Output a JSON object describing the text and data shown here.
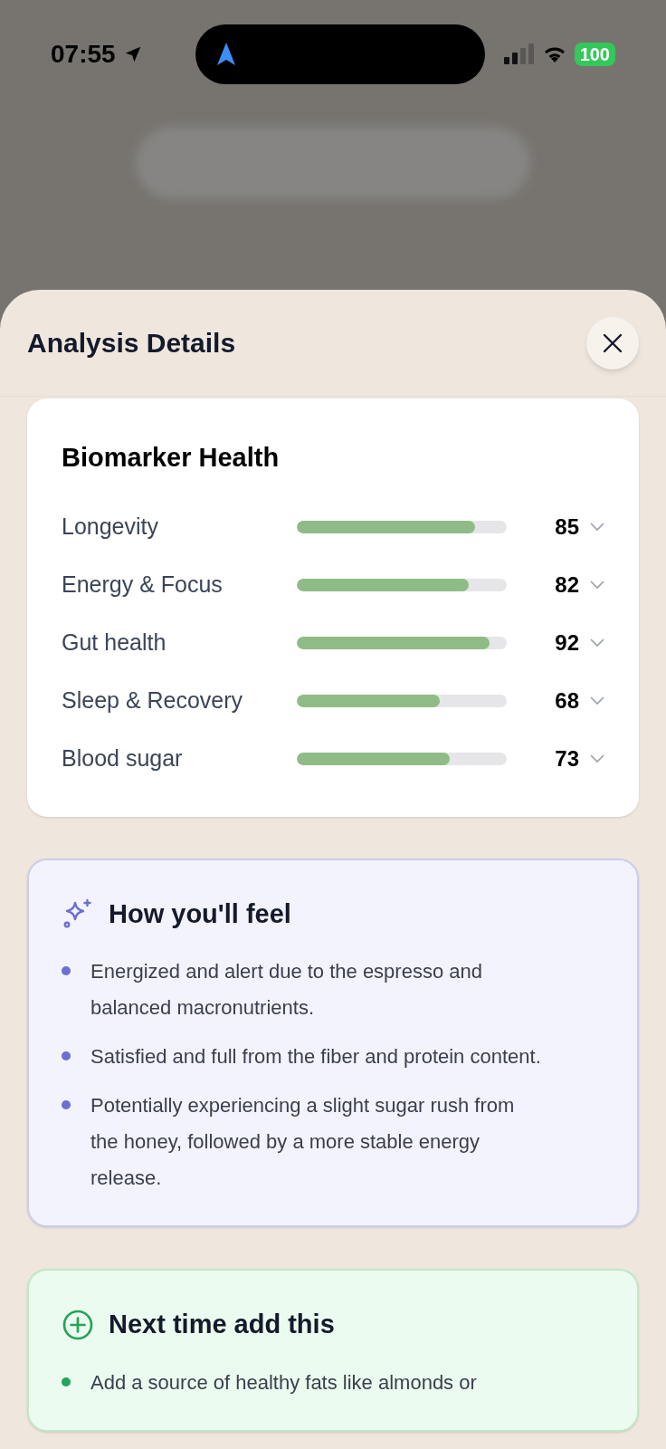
{
  "status_bar": {
    "time": "07:55",
    "battery": "100"
  },
  "sheet": {
    "title": "Analysis Details"
  },
  "biomarker_card": {
    "title": "Biomarker Health",
    "rows": [
      {
        "label": "Longevity",
        "level": 0.85,
        "value": "85"
      },
      {
        "label": "Energy & Focus",
        "level": 0.82,
        "value": "82"
      },
      {
        "label": "Gut health",
        "level": 0.92,
        "value": "92"
      },
      {
        "label": "Sleep & Recovery",
        "level": 0.68,
        "value": "68"
      },
      {
        "label": "Blood sugar",
        "level": 0.73,
        "value": "73"
      }
    ]
  },
  "sections": [
    {
      "kind": "feel",
      "title": "How you'll feel",
      "items": [
        "Energized and alert due to the espresso and balanced macronutrients.",
        "Satisfied and full from the fiber and protein content.",
        "Potentially experiencing a slight sugar rush from the honey, followed by a more stable energy release."
      ]
    },
    {
      "kind": "add",
      "title": "Next time add this",
      "items": [
        "Add a source of healthy fats like almonds or"
      ]
    }
  ]
}
